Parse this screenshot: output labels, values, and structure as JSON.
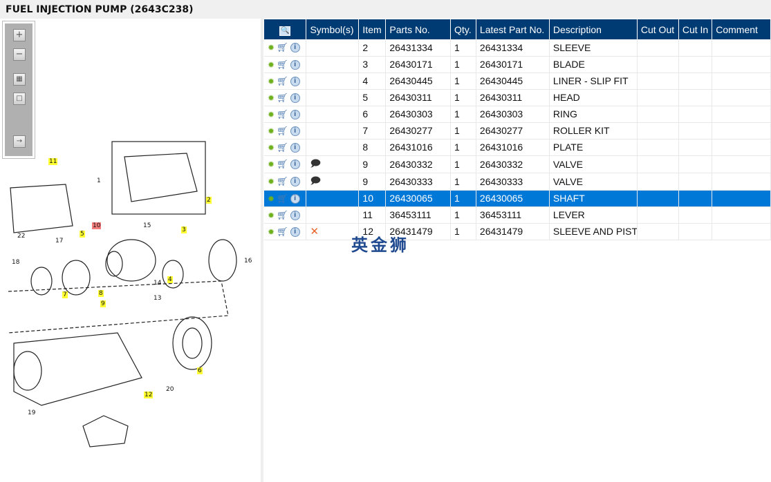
{
  "title": "FUEL INJECTION PUMP (2643C238)",
  "toolbar": {
    "zoom_in": "+",
    "zoom_out": "−",
    "fit": "fit",
    "actual": "actual",
    "export": "export"
  },
  "columns": [
    "",
    "Symbol(s)",
    "Item",
    "Parts No.",
    "Qty.",
    "Latest Part No.",
    "Description",
    "Cut Out",
    "Cut In",
    "Comment"
  ],
  "rows": [
    {
      "symbol": "",
      "item": "2",
      "part": "26431334",
      "qty": "1",
      "latest": "26431334",
      "desc": "SLEEVE"
    },
    {
      "symbol": "",
      "item": "3",
      "part": "26430171",
      "qty": "1",
      "latest": "26430171",
      "desc": "BLADE"
    },
    {
      "symbol": "",
      "item": "4",
      "part": "26430445",
      "qty": "1",
      "latest": "26430445",
      "desc": "LINER - SLIP FIT"
    },
    {
      "symbol": "",
      "item": "5",
      "part": "26430311",
      "qty": "1",
      "latest": "26430311",
      "desc": "HEAD"
    },
    {
      "symbol": "",
      "item": "6",
      "part": "26430303",
      "qty": "1",
      "latest": "26430303",
      "desc": "RING"
    },
    {
      "symbol": "",
      "item": "7",
      "part": "26430277",
      "qty": "1",
      "latest": "26430277",
      "desc": "ROLLER KIT"
    },
    {
      "symbol": "",
      "item": "8",
      "part": "26431016",
      "qty": "1",
      "latest": "26431016",
      "desc": "PLATE"
    },
    {
      "symbol": "note",
      "item": "9",
      "part": "26430332",
      "qty": "1",
      "latest": "26430332",
      "desc": "VALVE"
    },
    {
      "symbol": "note",
      "item": "9",
      "part": "26430333",
      "qty": "1",
      "latest": "26430333",
      "desc": "VALVE"
    },
    {
      "symbol": "",
      "item": "10",
      "part": "26430065",
      "qty": "1",
      "latest": "26430065",
      "desc": "SHAFT",
      "selected": true
    },
    {
      "symbol": "",
      "item": "11",
      "part": "36453111",
      "qty": "1",
      "latest": "36453111",
      "desc": "LEVER"
    },
    {
      "symbol": "x",
      "item": "12",
      "part": "26431479",
      "qty": "1",
      "latest": "26431479",
      "desc": "SLEEVE AND PISTO"
    }
  ],
  "watermark": "英金狮",
  "diagram_labels": {
    "l1": "1",
    "l2": "2",
    "l3": "3",
    "l4": "4",
    "l5": "5",
    "l6": "6",
    "l7": "7",
    "l8": "8",
    "l9": "9",
    "l10": "10",
    "l11": "11",
    "l12": "12",
    "l13": "13",
    "l14": "14",
    "l15": "15",
    "l16": "16",
    "l17": "17",
    "l18": "18",
    "l19": "19",
    "l20": "20",
    "l22": "22"
  },
  "colors": {
    "header": "#003b73",
    "selected": "#0078d7",
    "highlight": "#ffff33",
    "highlight_selected": "#f37c7c"
  }
}
